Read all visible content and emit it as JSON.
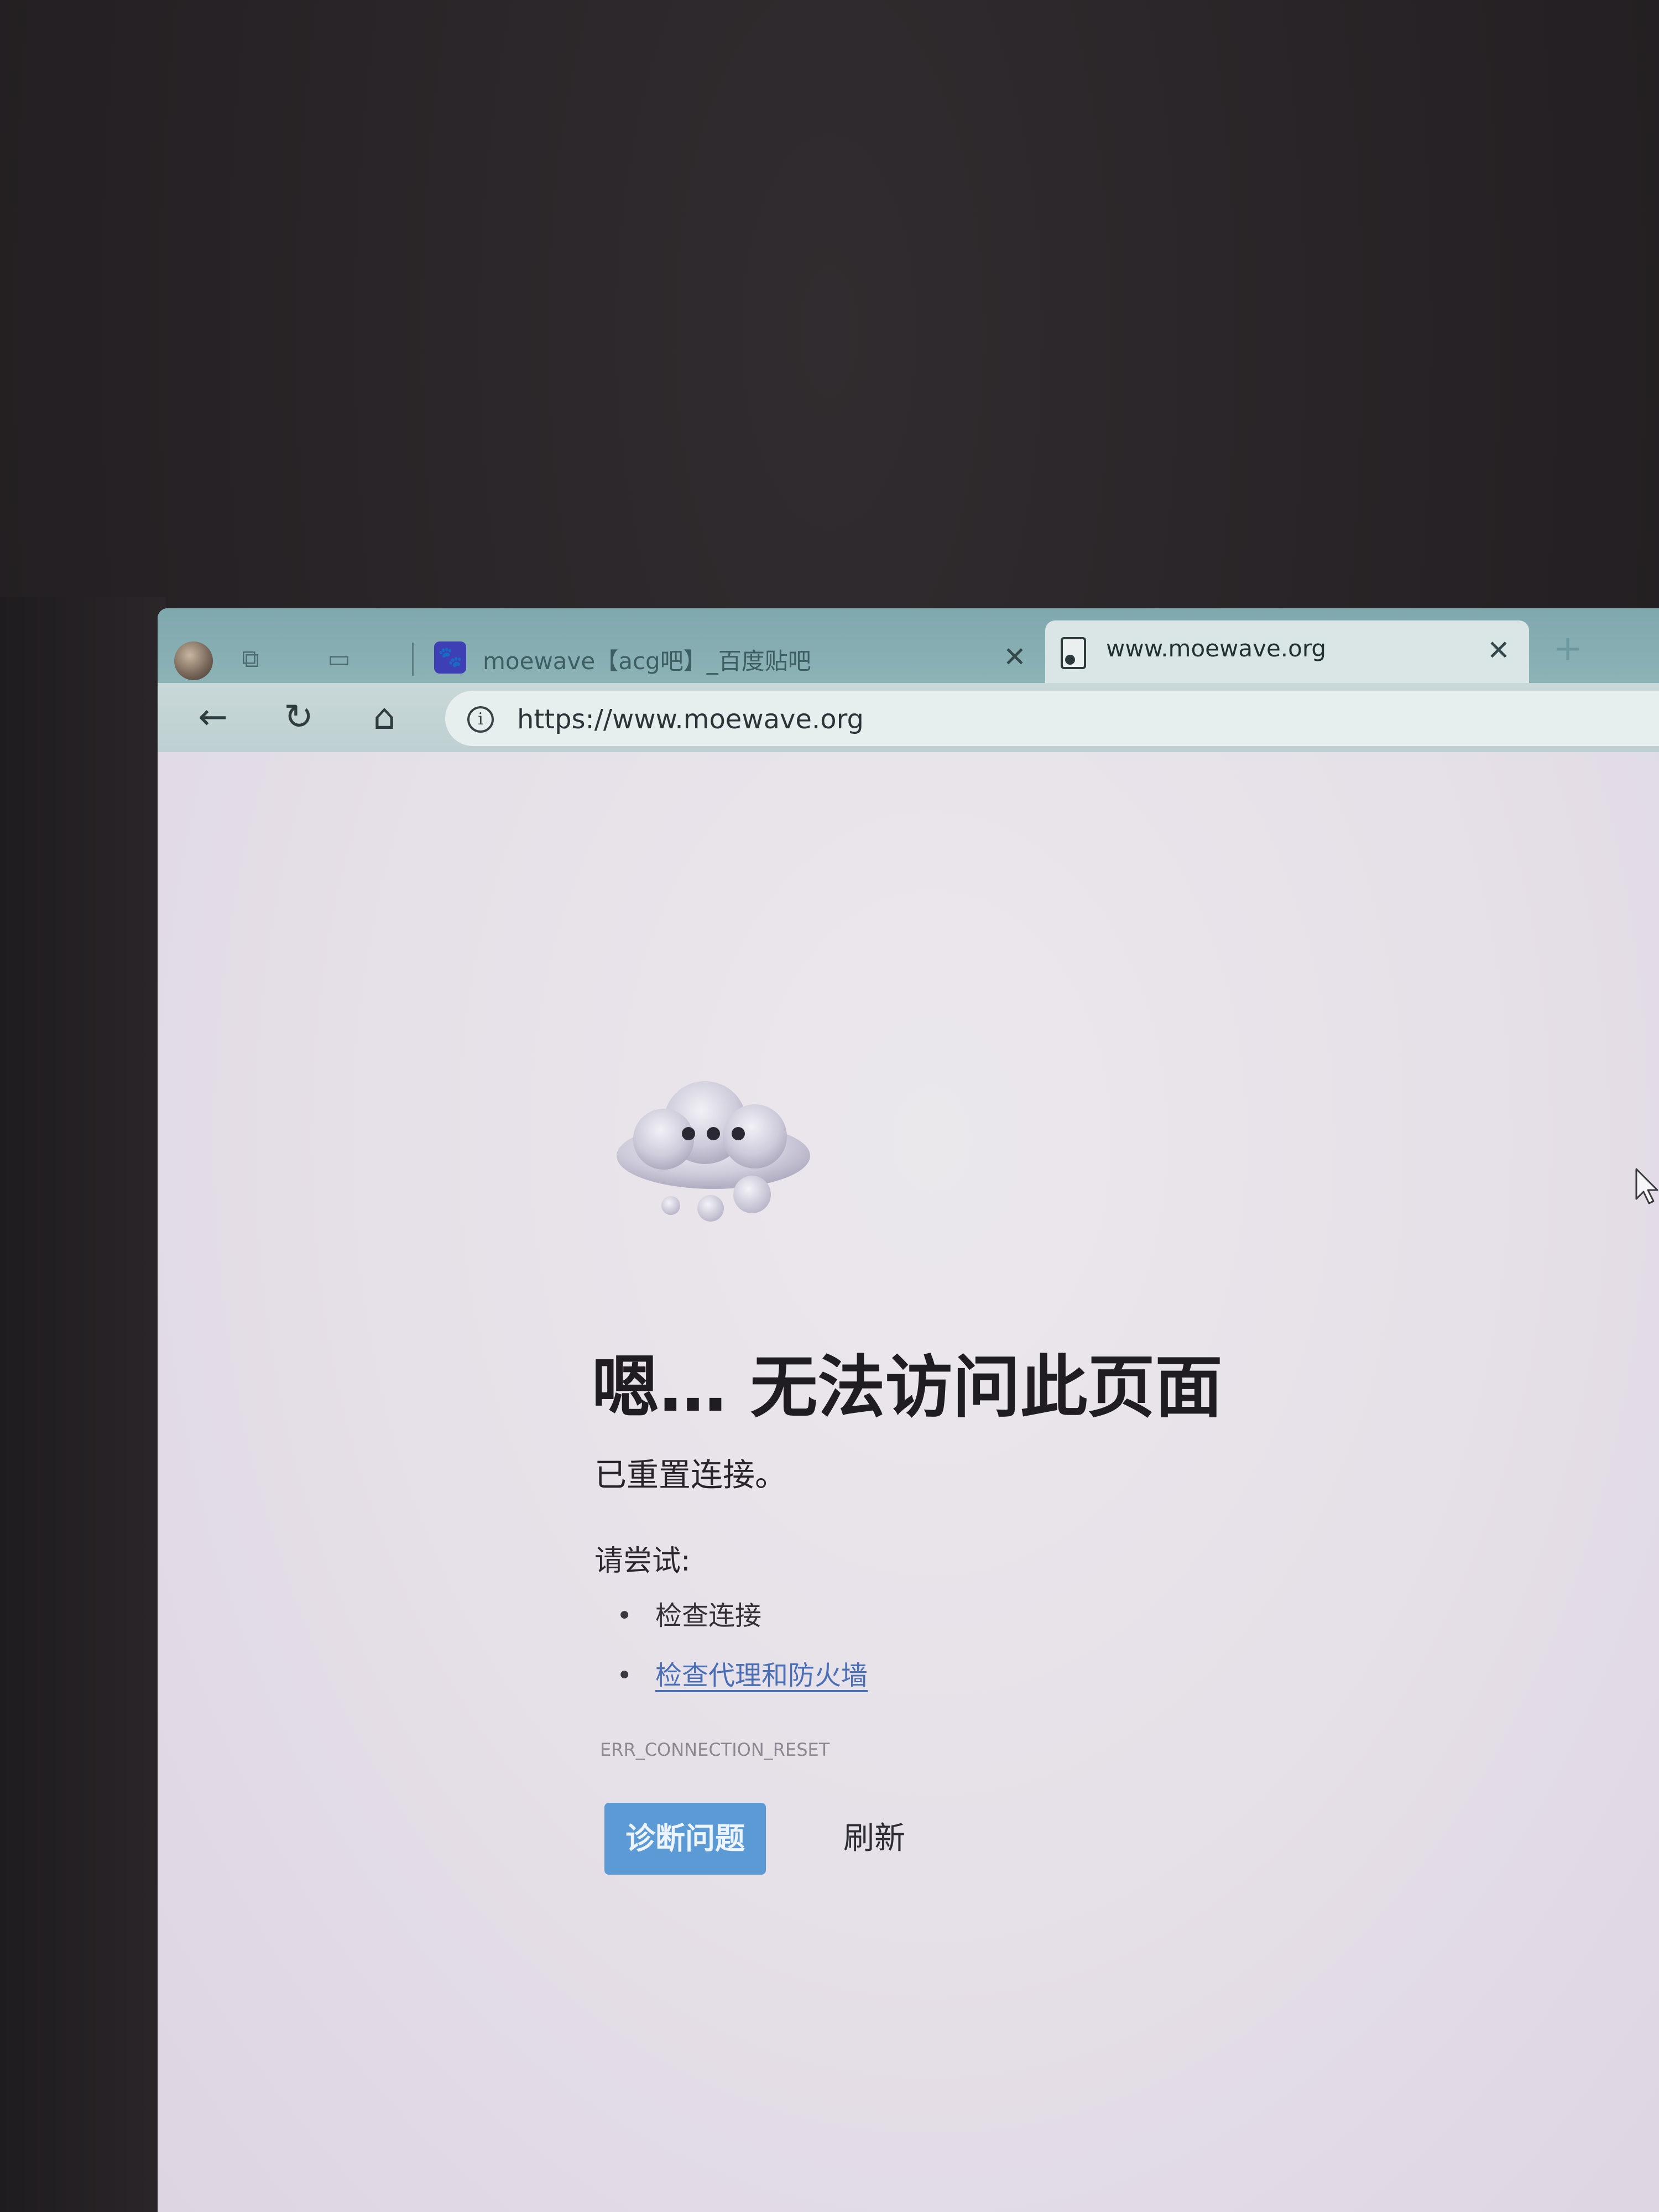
{
  "browser": {
    "tabs": [
      {
        "title": "moewave【acg吧】_百度贴吧",
        "active": false,
        "favicon": "baidu-paw-icon"
      },
      {
        "title": "www.moewave.org",
        "active": true,
        "favicon": "document-icon"
      }
    ],
    "new_tab_label": "+",
    "address_bar": {
      "url": "https://www.moewave.org",
      "security_icon": "info-icon"
    },
    "toolbar_icons": [
      "back-arrow-icon",
      "refresh-icon",
      "home-icon"
    ],
    "colors": {
      "tabstrip": "#8cb3b6",
      "toolbar": "#c8d8d8",
      "primary_button": "#5c9ad6",
      "link": "#4a6fb5"
    }
  },
  "error_page": {
    "title": "嗯… 无法访问此页面",
    "description": "已重置连接。",
    "try_label": "请尝试:",
    "suggestions": [
      {
        "text": "检查连接",
        "is_link": false
      },
      {
        "text": "检查代理和防火墙",
        "is_link": true
      }
    ],
    "error_code": "ERR_CONNECTION_RESET",
    "primary_button": "诊断问题",
    "secondary_button": "刷新"
  }
}
